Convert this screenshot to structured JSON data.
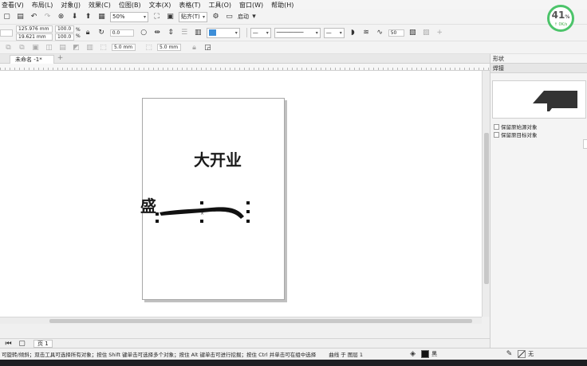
{
  "menu": [
    "查看(V)",
    "布局(L)",
    "对象(J)",
    "效果(C)",
    "位图(B)",
    "文本(X)",
    "表格(T)",
    "工具(O)",
    "窗口(W)",
    "帮助(H)"
  ],
  "toolbar1": {
    "zoom": "50%",
    "snap_label": "贴齐(T)",
    "launch_label": "启动"
  },
  "toolbar2": {
    "pos_x": "125.976 mm",
    "pos_y": "19.621 mm",
    "scale_x": "100.0",
    "scale_y": "100.0",
    "pct_unit": "%",
    "angle": "0.0",
    "smooth": "50"
  },
  "toolbar3": {
    "width1": "5.0 mm",
    "width2": "5.0 mm"
  },
  "doc_tab": {
    "name": "未命名 -1*",
    "add": "+"
  },
  "canvas": {
    "text_top": "大开业",
    "text_left": "盛"
  },
  "page_tab": "页 1",
  "status": {
    "hint": "可旋转/倾斜；双击工具可选择所有对象；按住 Shift 键单击可选择多个对象；按住 Alt 键单击可进行挖掘；按住 Ctrl 并单击可在组中选择",
    "object": "曲线 于 图层 1",
    "fill": "黑",
    "outline": "无",
    "fill_color": "#111111"
  },
  "panel": {
    "title": "形状",
    "subtitle": "焊接",
    "opt1": "保留原始源对象",
    "opt2": "保留原目标对象"
  },
  "badge": {
    "percent": "41",
    "unit": "%",
    "rate": "↑ 0K/s"
  }
}
